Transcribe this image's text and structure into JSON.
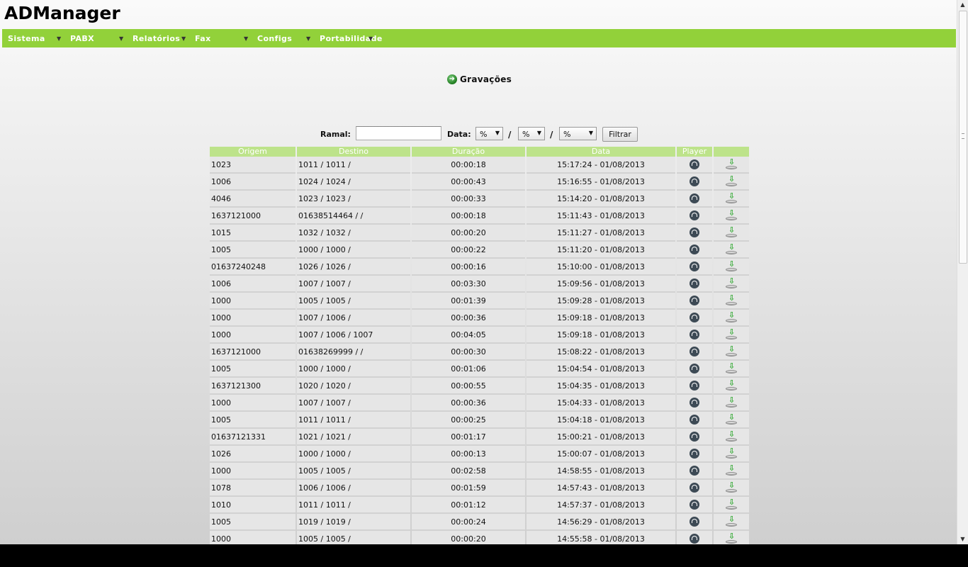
{
  "app": {
    "title": "ADManager"
  },
  "menu": [
    {
      "label": "Sistema"
    },
    {
      "label": "PABX"
    },
    {
      "label": "Relatórios"
    },
    {
      "label": "Fax"
    },
    {
      "label": "Configs"
    },
    {
      "label": "Portabilidade"
    }
  ],
  "page": {
    "heading": "Gravações",
    "heading_icon": "go-arrow-icon"
  },
  "filter": {
    "ramal_label": "Ramal:",
    "ramal_value": "",
    "data_label": "Data:",
    "day": "%",
    "month": "%",
    "year": "%",
    "separator": "/",
    "submit_label": "Filtrar"
  },
  "table": {
    "columns": [
      "Origem",
      "Destino",
      "Duração",
      "Data",
      "Player",
      ""
    ],
    "rows": [
      [
        "1023",
        "1011 / 1011 /",
        "00:00:18",
        "15:17:24 - 01/08/2013"
      ],
      [
        "1006",
        "1024 / 1024 /",
        "00:00:43",
        "15:16:55 - 01/08/2013"
      ],
      [
        "4046",
        "1023 / 1023 /",
        "00:00:33",
        "15:14:20 - 01/08/2013"
      ],
      [
        "1637121000",
        "01638514464 / /",
        "00:00:18",
        "15:11:43 - 01/08/2013"
      ],
      [
        "1015",
        "1032 / 1032 /",
        "00:00:20",
        "15:11:27 - 01/08/2013"
      ],
      [
        "1005",
        "1000 / 1000 /",
        "00:00:22",
        "15:11:20 - 01/08/2013"
      ],
      [
        "01637240248",
        "1026 / 1026 /",
        "00:00:16",
        "15:10:00 - 01/08/2013"
      ],
      [
        "1006",
        "1007 / 1007 /",
        "00:03:30",
        "15:09:56 - 01/08/2013"
      ],
      [
        "1000",
        "1005 / 1005 /",
        "00:01:39",
        "15:09:28 - 01/08/2013"
      ],
      [
        "1000",
        "1007 / 1006 /",
        "00:00:36",
        "15:09:18 - 01/08/2013"
      ],
      [
        "1000",
        "1007 / 1006 / 1007",
        "00:04:05",
        "15:09:18 - 01/08/2013"
      ],
      [
        "1637121000",
        "01638269999 / /",
        "00:00:30",
        "15:08:22 - 01/08/2013"
      ],
      [
        "1005",
        "1000 / 1000 /",
        "00:01:06",
        "15:04:54 - 01/08/2013"
      ],
      [
        "1637121300",
        "1020 / 1020 /",
        "00:00:55",
        "15:04:35 - 01/08/2013"
      ],
      [
        "1000",
        "1007 / 1007 /",
        "00:00:36",
        "15:04:33 - 01/08/2013"
      ],
      [
        "1005",
        "1011 / 1011 /",
        "00:00:25",
        "15:04:18 - 01/08/2013"
      ],
      [
        "01637121331",
        "1021 / 1021 /",
        "00:01:17",
        "15:00:21 - 01/08/2013"
      ],
      [
        "1026",
        "1000 / 1000 /",
        "00:00:13",
        "15:00:07 - 01/08/2013"
      ],
      [
        "1000",
        "1005 / 1005 /",
        "00:02:58",
        "14:58:55 - 01/08/2013"
      ],
      [
        "1078",
        "1006 / 1006 /",
        "00:01:59",
        "14:57:43 - 01/08/2013"
      ],
      [
        "1010",
        "1011 / 1011 /",
        "00:01:12",
        "14:57:37 - 01/08/2013"
      ],
      [
        "1005",
        "1019 / 1019 /",
        "00:00:24",
        "14:56:29 - 01/08/2013"
      ],
      [
        "1000",
        "1005 / 1005 /",
        "00:00:20",
        "14:55:58 - 01/08/2013"
      ]
    ],
    "row_icons": {
      "player": "headphones-icon",
      "download": "download-icon"
    }
  },
  "colors": {
    "menubar": "#92d13a",
    "header": "#bde38a",
    "row": "#e6e6e6"
  }
}
